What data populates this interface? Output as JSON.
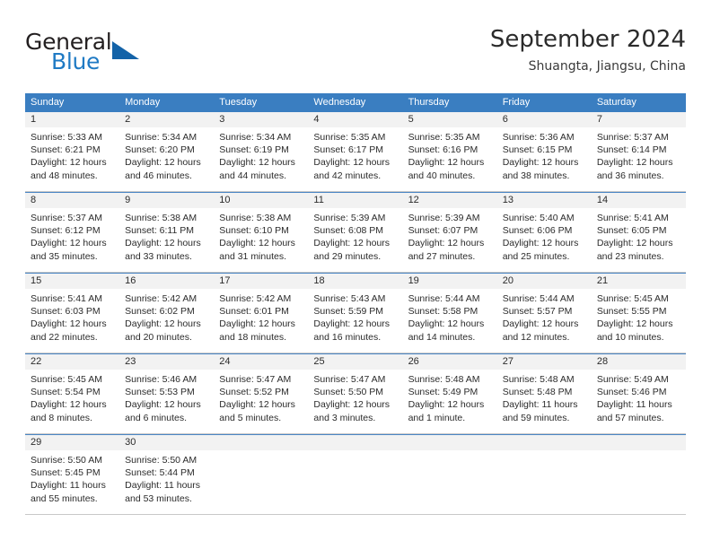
{
  "brand": {
    "name_part1": "General",
    "name_part2": "Blue",
    "triangle_color": "#1463a8",
    "blue_color": "#1f7ac4"
  },
  "header": {
    "title": "September 2024",
    "subtitle": "Shuangta, Jiangsu, China"
  },
  "theme": {
    "header_row_bg": "#3a7ec1",
    "day_band_bg": "#f2f2f2",
    "week_divider": "#4a86c5",
    "text": "#2b2b2b"
  },
  "weekdays": [
    "Sunday",
    "Monday",
    "Tuesday",
    "Wednesday",
    "Thursday",
    "Friday",
    "Saturday"
  ],
  "weeks": [
    {
      "days": [
        {
          "num": "1",
          "sunrise": "Sunrise: 5:33 AM",
          "sunset": "Sunset: 6:21 PM",
          "daylight1": "Daylight: 12 hours",
          "daylight2": "and 48 minutes."
        },
        {
          "num": "2",
          "sunrise": "Sunrise: 5:34 AM",
          "sunset": "Sunset: 6:20 PM",
          "daylight1": "Daylight: 12 hours",
          "daylight2": "and 46 minutes."
        },
        {
          "num": "3",
          "sunrise": "Sunrise: 5:34 AM",
          "sunset": "Sunset: 6:19 PM",
          "daylight1": "Daylight: 12 hours",
          "daylight2": "and 44 minutes."
        },
        {
          "num": "4",
          "sunrise": "Sunrise: 5:35 AM",
          "sunset": "Sunset: 6:17 PM",
          "daylight1": "Daylight: 12 hours",
          "daylight2": "and 42 minutes."
        },
        {
          "num": "5",
          "sunrise": "Sunrise: 5:35 AM",
          "sunset": "Sunset: 6:16 PM",
          "daylight1": "Daylight: 12 hours",
          "daylight2": "and 40 minutes."
        },
        {
          "num": "6",
          "sunrise": "Sunrise: 5:36 AM",
          "sunset": "Sunset: 6:15 PM",
          "daylight1": "Daylight: 12 hours",
          "daylight2": "and 38 minutes."
        },
        {
          "num": "7",
          "sunrise": "Sunrise: 5:37 AM",
          "sunset": "Sunset: 6:14 PM",
          "daylight1": "Daylight: 12 hours",
          "daylight2": "and 36 minutes."
        }
      ]
    },
    {
      "days": [
        {
          "num": "8",
          "sunrise": "Sunrise: 5:37 AM",
          "sunset": "Sunset: 6:12 PM",
          "daylight1": "Daylight: 12 hours",
          "daylight2": "and 35 minutes."
        },
        {
          "num": "9",
          "sunrise": "Sunrise: 5:38 AM",
          "sunset": "Sunset: 6:11 PM",
          "daylight1": "Daylight: 12 hours",
          "daylight2": "and 33 minutes."
        },
        {
          "num": "10",
          "sunrise": "Sunrise: 5:38 AM",
          "sunset": "Sunset: 6:10 PM",
          "daylight1": "Daylight: 12 hours",
          "daylight2": "and 31 minutes."
        },
        {
          "num": "11",
          "sunrise": "Sunrise: 5:39 AM",
          "sunset": "Sunset: 6:08 PM",
          "daylight1": "Daylight: 12 hours",
          "daylight2": "and 29 minutes."
        },
        {
          "num": "12",
          "sunrise": "Sunrise: 5:39 AM",
          "sunset": "Sunset: 6:07 PM",
          "daylight1": "Daylight: 12 hours",
          "daylight2": "and 27 minutes."
        },
        {
          "num": "13",
          "sunrise": "Sunrise: 5:40 AM",
          "sunset": "Sunset: 6:06 PM",
          "daylight1": "Daylight: 12 hours",
          "daylight2": "and 25 minutes."
        },
        {
          "num": "14",
          "sunrise": "Sunrise: 5:41 AM",
          "sunset": "Sunset: 6:05 PM",
          "daylight1": "Daylight: 12 hours",
          "daylight2": "and 23 minutes."
        }
      ]
    },
    {
      "days": [
        {
          "num": "15",
          "sunrise": "Sunrise: 5:41 AM",
          "sunset": "Sunset: 6:03 PM",
          "daylight1": "Daylight: 12 hours",
          "daylight2": "and 22 minutes."
        },
        {
          "num": "16",
          "sunrise": "Sunrise: 5:42 AM",
          "sunset": "Sunset: 6:02 PM",
          "daylight1": "Daylight: 12 hours",
          "daylight2": "and 20 minutes."
        },
        {
          "num": "17",
          "sunrise": "Sunrise: 5:42 AM",
          "sunset": "Sunset: 6:01 PM",
          "daylight1": "Daylight: 12 hours",
          "daylight2": "and 18 minutes."
        },
        {
          "num": "18",
          "sunrise": "Sunrise: 5:43 AM",
          "sunset": "Sunset: 5:59 PM",
          "daylight1": "Daylight: 12 hours",
          "daylight2": "and 16 minutes."
        },
        {
          "num": "19",
          "sunrise": "Sunrise: 5:44 AM",
          "sunset": "Sunset: 5:58 PM",
          "daylight1": "Daylight: 12 hours",
          "daylight2": "and 14 minutes."
        },
        {
          "num": "20",
          "sunrise": "Sunrise: 5:44 AM",
          "sunset": "Sunset: 5:57 PM",
          "daylight1": "Daylight: 12 hours",
          "daylight2": "and 12 minutes."
        },
        {
          "num": "21",
          "sunrise": "Sunrise: 5:45 AM",
          "sunset": "Sunset: 5:55 PM",
          "daylight1": "Daylight: 12 hours",
          "daylight2": "and 10 minutes."
        }
      ]
    },
    {
      "days": [
        {
          "num": "22",
          "sunrise": "Sunrise: 5:45 AM",
          "sunset": "Sunset: 5:54 PM",
          "daylight1": "Daylight: 12 hours",
          "daylight2": "and 8 minutes."
        },
        {
          "num": "23",
          "sunrise": "Sunrise: 5:46 AM",
          "sunset": "Sunset: 5:53 PM",
          "daylight1": "Daylight: 12 hours",
          "daylight2": "and 6 minutes."
        },
        {
          "num": "24",
          "sunrise": "Sunrise: 5:47 AM",
          "sunset": "Sunset: 5:52 PM",
          "daylight1": "Daylight: 12 hours",
          "daylight2": "and 5 minutes."
        },
        {
          "num": "25",
          "sunrise": "Sunrise: 5:47 AM",
          "sunset": "Sunset: 5:50 PM",
          "daylight1": "Daylight: 12 hours",
          "daylight2": "and 3 minutes."
        },
        {
          "num": "26",
          "sunrise": "Sunrise: 5:48 AM",
          "sunset": "Sunset: 5:49 PM",
          "daylight1": "Daylight: 12 hours",
          "daylight2": "and 1 minute."
        },
        {
          "num": "27",
          "sunrise": "Sunrise: 5:48 AM",
          "sunset": "Sunset: 5:48 PM",
          "daylight1": "Daylight: 11 hours",
          "daylight2": "and 59 minutes."
        },
        {
          "num": "28",
          "sunrise": "Sunrise: 5:49 AM",
          "sunset": "Sunset: 5:46 PM",
          "daylight1": "Daylight: 11 hours",
          "daylight2": "and 57 minutes."
        }
      ]
    },
    {
      "days": [
        {
          "num": "29",
          "sunrise": "Sunrise: 5:50 AM",
          "sunset": "Sunset: 5:45 PM",
          "daylight1": "Daylight: 11 hours",
          "daylight2": "and 55 minutes."
        },
        {
          "num": "30",
          "sunrise": "Sunrise: 5:50 AM",
          "sunset": "Sunset: 5:44 PM",
          "daylight1": "Daylight: 11 hours",
          "daylight2": "and 53 minutes."
        },
        {
          "num": "",
          "sunrise": "",
          "sunset": "",
          "daylight1": "",
          "daylight2": ""
        },
        {
          "num": "",
          "sunrise": "",
          "sunset": "",
          "daylight1": "",
          "daylight2": ""
        },
        {
          "num": "",
          "sunrise": "",
          "sunset": "",
          "daylight1": "",
          "daylight2": ""
        },
        {
          "num": "",
          "sunrise": "",
          "sunset": "",
          "daylight1": "",
          "daylight2": ""
        },
        {
          "num": "",
          "sunrise": "",
          "sunset": "",
          "daylight1": "",
          "daylight2": ""
        }
      ]
    }
  ]
}
